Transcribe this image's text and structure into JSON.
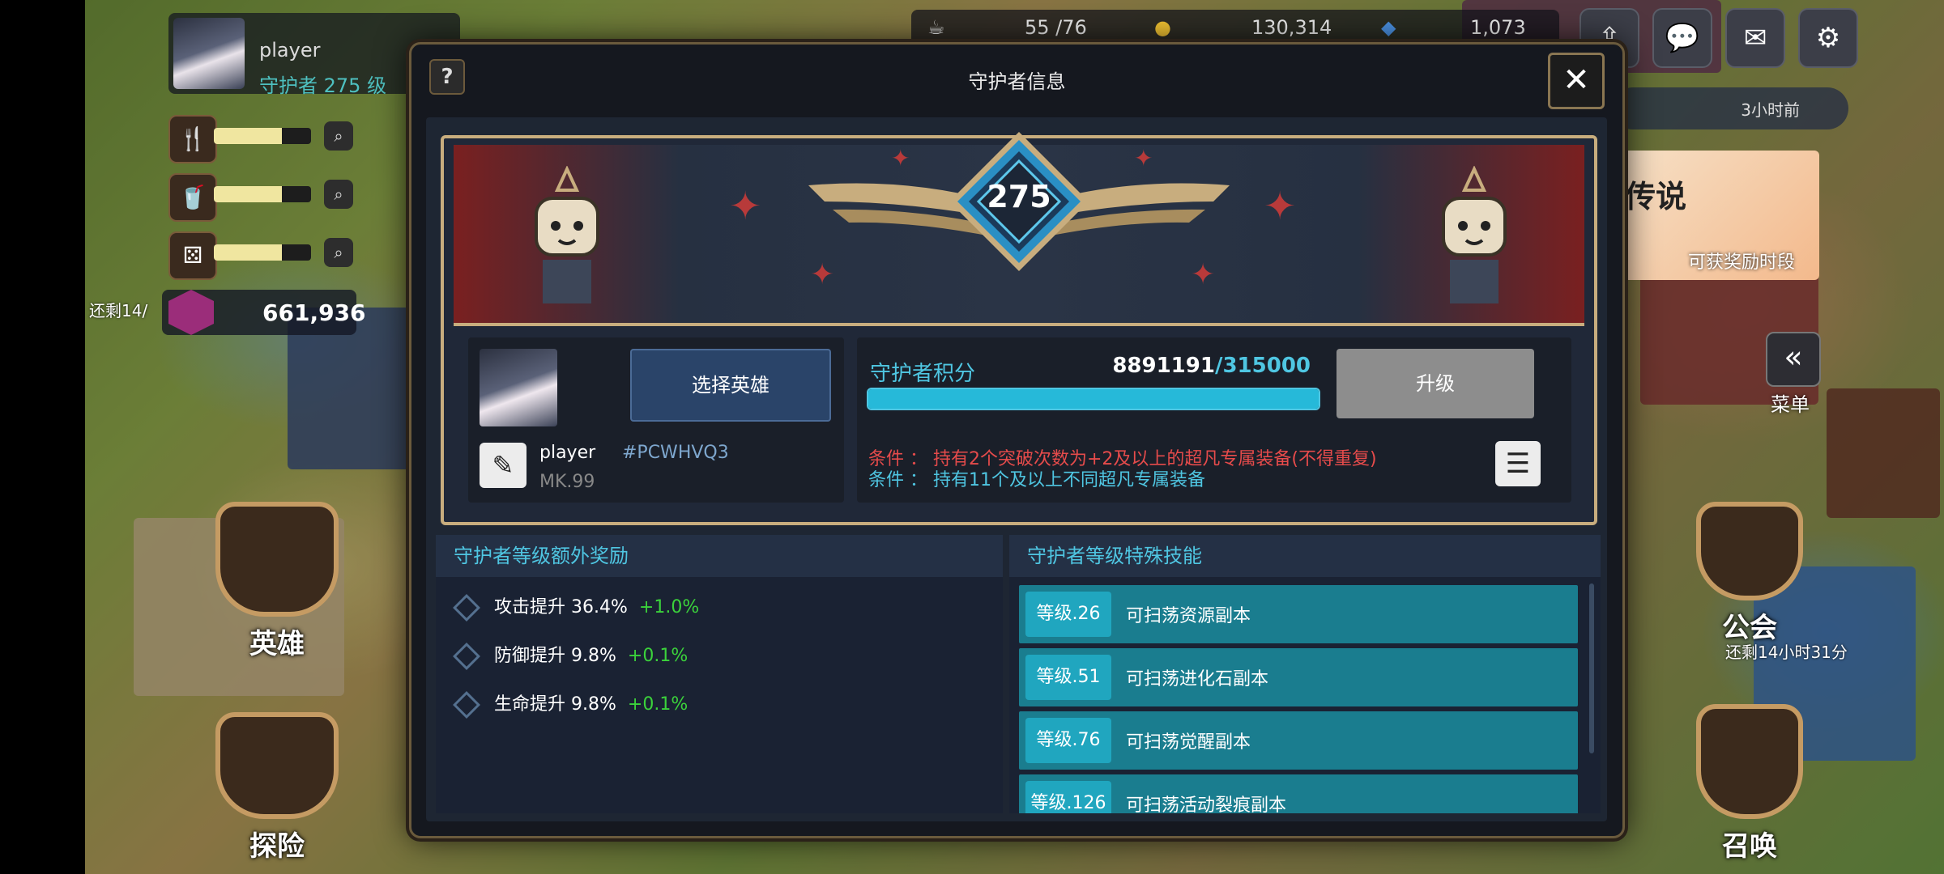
{
  "profile": {
    "name": "player",
    "level": "守护者 275 级"
  },
  "resources": {
    "gems": "661,936",
    "gem_note": "还剩14/"
  },
  "topbar": {
    "stamina": "55 /76",
    "gold": "130,314",
    "crystal": "1,073"
  },
  "side": {
    "time_ago": "3小时前",
    "promo_title": "传说",
    "promo_sub": "可获奖励时段",
    "menu": "菜单",
    "guild_timer": "还剩14小时31分"
  },
  "nav": {
    "heroes": "英雄",
    "explore": "探险",
    "guild": "公会",
    "summon": "召唤"
  },
  "modal": {
    "title": "守护者信息",
    "help": "?",
    "close": "✕",
    "badge_level": "275",
    "hero": {
      "name": "player",
      "code": "#PCWHVQ3",
      "mk": "MK.99",
      "select": "选择英雄"
    },
    "score": {
      "label": "守护者积分",
      "current": "8891191",
      "target": "/315000",
      "progress": 1.0,
      "upgrade": "升级"
    },
    "conditions": [
      "条件 ： 持有2个突破次数为+2及以上的超凡专属装备(不得重复)",
      "条件 ： 持有11个及以上不同超凡专属装备"
    ],
    "bonus": {
      "title": "守护者等级额外奖励",
      "items": [
        {
          "label": "攻击提升",
          "value": "36.4%",
          "plus": "+1.0%"
        },
        {
          "label": "防御提升",
          "value": "9.8%",
          "plus": "+0.1%"
        },
        {
          "label": "生命提升",
          "value": "9.8%",
          "plus": "+0.1%"
        }
      ]
    },
    "skills": {
      "title": "守护者等级特殊技能",
      "items": [
        {
          "level": "等级.26",
          "text": "可扫荡资源副本"
        },
        {
          "level": "等级.51",
          "text": "可扫荡进化石副本"
        },
        {
          "level": "等级.76",
          "text": "可扫荡觉醒副本"
        },
        {
          "level": "等级.126",
          "text": "可扫荡活动裂痕副本"
        }
      ]
    }
  },
  "colors": {
    "accent": "#4fc6e2",
    "condition_red": "#e64b4b",
    "bonus_green": "#3bd23b"
  }
}
